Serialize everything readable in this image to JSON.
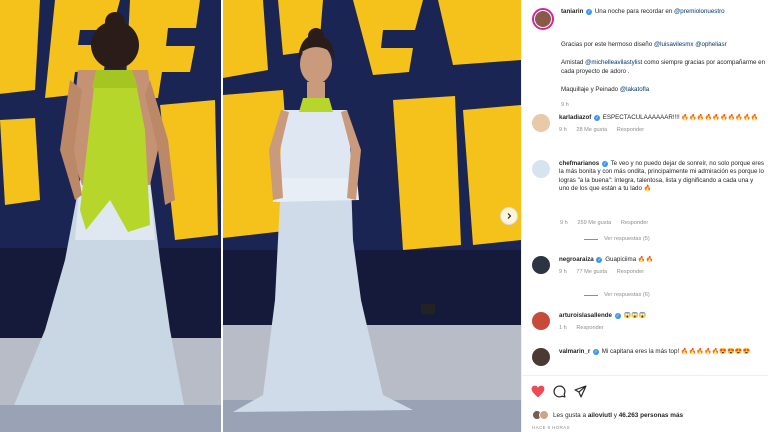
{
  "post": {
    "author": "taniarin",
    "caption_line1": "Una noche para recordar en",
    "caption_mention": "@premiolonuestro",
    "para1_text": "Gracias por este hermoso diseño",
    "para1_mention1": "@luisavilesmx",
    "para1_mention2": "@opheliasr",
    "para2_pre": "Amistad",
    "para2_mention": "@michelleavilastylist",
    "para2_post": "como siempre gracias por acompañarme en cada proyecto de adoro .",
    "para3_pre": "Maquillaje y Peinado",
    "para3_mention": "@lakatofla",
    "time": "9 h"
  },
  "comments": [
    {
      "user": "karladiazof",
      "text": "ESPECTACULAAAAAAR!!!! 🔥🔥🔥🔥🔥🔥🔥🔥🔥🔥",
      "time": "9 h",
      "likes": "28 Me gusta",
      "reply": "Responder",
      "avatar_color": "#e8c9a8"
    },
    {
      "user": "chefmarianos",
      "text": "Te veo y no puedo dejar de sonreír, no solo porque eres la más bonita y con más ondita, principalmente mi admiración es porque lo logras \"a la buena\": íntegra, talentosa, lista y dignificando a cada una y uno de los que están a tu lado 🔥",
      "time": "9 h",
      "likes": "259 Me gusta",
      "reply": "Responder",
      "view_replies": "Ver respuestas (5)",
      "avatar_color": "#d7e3ef"
    },
    {
      "user": "negroaraiza",
      "text": "Guapiciima 🔥🔥",
      "time": "9 h",
      "likes": "77 Me gusta",
      "reply": "Responder",
      "view_replies": "Ver respuestas (6)",
      "avatar_color": "#2b3440"
    },
    {
      "user": "arturoislasallende",
      "text": "😱😱😱",
      "time": "1 h",
      "reply": "Responder",
      "avatar_color": "#c74a3a"
    },
    {
      "user": "valmarin_r",
      "text": "Mi capitana eres la más top! 🔥🔥🔥🔥🔥😍😍😍😍",
      "avatar_color": "#4a3a33"
    }
  ],
  "likes": {
    "prefix": "Les gusta a",
    "user": "ailoviutl",
    "middle": "y",
    "count": "46.263 personas más"
  },
  "date": "HACE 9 HORAS",
  "colors": {
    "mention": "#00376b",
    "verified": "#3897f0",
    "like_red": "#ed4956",
    "stage_yellow": "#f4c21a",
    "stage_blue": "#1b2553",
    "halter_lime": "#b6d62b"
  },
  "icons": [
    "heart-icon",
    "comment-icon",
    "share-icon",
    "next-arrow-icon",
    "verified-icon"
  ]
}
